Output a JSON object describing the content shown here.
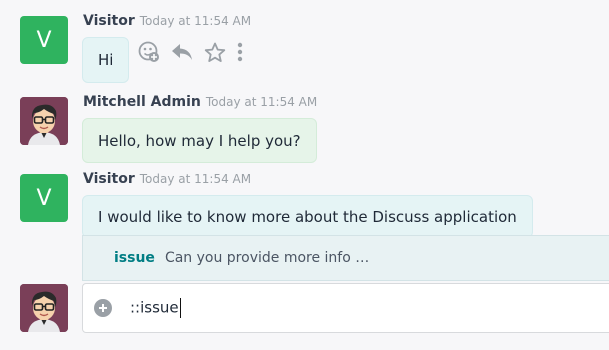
{
  "messages": [
    {
      "author": "Visitor",
      "time": "Today at 11:54 AM",
      "avatar_letter": "V",
      "text": "Hi"
    },
    {
      "author": "Mitchell Admin",
      "time": "Today at 11:54 AM",
      "text": "Hello, how may I help you?"
    },
    {
      "author": "Visitor",
      "time": "Today at 11:54 AM",
      "avatar_letter": "V",
      "text": "I would like to know more about the Discuss application"
    }
  ],
  "message_actions": [
    "add-reaction-icon",
    "reply-icon",
    "star-icon",
    "more-vertical-icon"
  ],
  "suggestion": {
    "keyword": "issue",
    "description": "Can you provide more info …"
  },
  "composer": {
    "value": "::issue"
  },
  "colors": {
    "visitor_avatar": "#2fb35f",
    "visitor_bubble": "#e5f4f5",
    "admin_bubble": "#e6f4e9",
    "accent": "#017e84"
  }
}
